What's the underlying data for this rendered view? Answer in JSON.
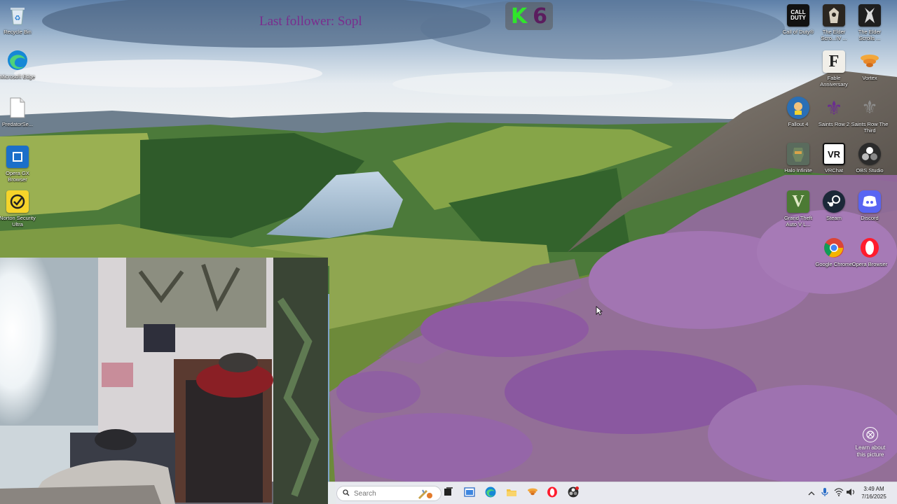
{
  "overlay": {
    "last_follower": "Last follower: Sopl",
    "kill_letter": "K",
    "kill_count": "6"
  },
  "desktop_left": [
    {
      "label": "Recycle Bin",
      "icon": "recycle-bin-icon"
    },
    {
      "label": "Microsoft Edge",
      "icon": "edge-icon"
    },
    {
      "label": "PredatorSe...",
      "icon": "file-icon"
    },
    {
      "label": "Opera GX Browser",
      "icon": "opera-gx-icon"
    },
    {
      "label": "Norton Security Ultra",
      "icon": "norton-icon"
    }
  ],
  "desktop_right": [
    {
      "label": "Call of Duty®",
      "icon": "call-of-duty-icon"
    },
    {
      "label": "The Elder Scro...IV ...",
      "icon": "elder-scrolls-iv-icon"
    },
    {
      "label": "The Elder Scrolls ...",
      "icon": "elder-scrolls-v-icon"
    },
    {
      "label": "Fable Anniversary",
      "icon": "fable-icon"
    },
    {
      "label": "Vortex",
      "icon": "vortex-icon"
    },
    {
      "label": "Fallout 4",
      "icon": "fallout-4-icon"
    },
    {
      "label": "Saints Row 2",
      "icon": "saints-row-2-icon"
    },
    {
      "label": "Saints Row The Third",
      "icon": "saints-row-3-icon"
    },
    {
      "label": "Halo Infinite",
      "icon": "halo-infinite-icon"
    },
    {
      "label": "VRChat",
      "icon": "vrchat-icon"
    },
    {
      "label": "OBS Studio",
      "icon": "obs-icon"
    },
    {
      "label": "Grand Theft Auto V L...",
      "icon": "gta-v-icon"
    },
    {
      "label": "Steam",
      "icon": "steam-icon"
    },
    {
      "label": "Discord",
      "icon": "discord-icon"
    },
    {
      "label": "Google Chrome",
      "icon": "chrome-icon"
    },
    {
      "label": "Opera Browser",
      "icon": "opera-icon"
    }
  ],
  "learn_about": "Learn about this picture",
  "taskbar": {
    "search_placeholder": "Search",
    "time": "3:49 AM",
    "date": "7/16/2025"
  },
  "colors": {
    "follower_text": "#7a2d8e",
    "kill_letter": "#2fe62b",
    "kill_count": "#5b1d5e"
  }
}
